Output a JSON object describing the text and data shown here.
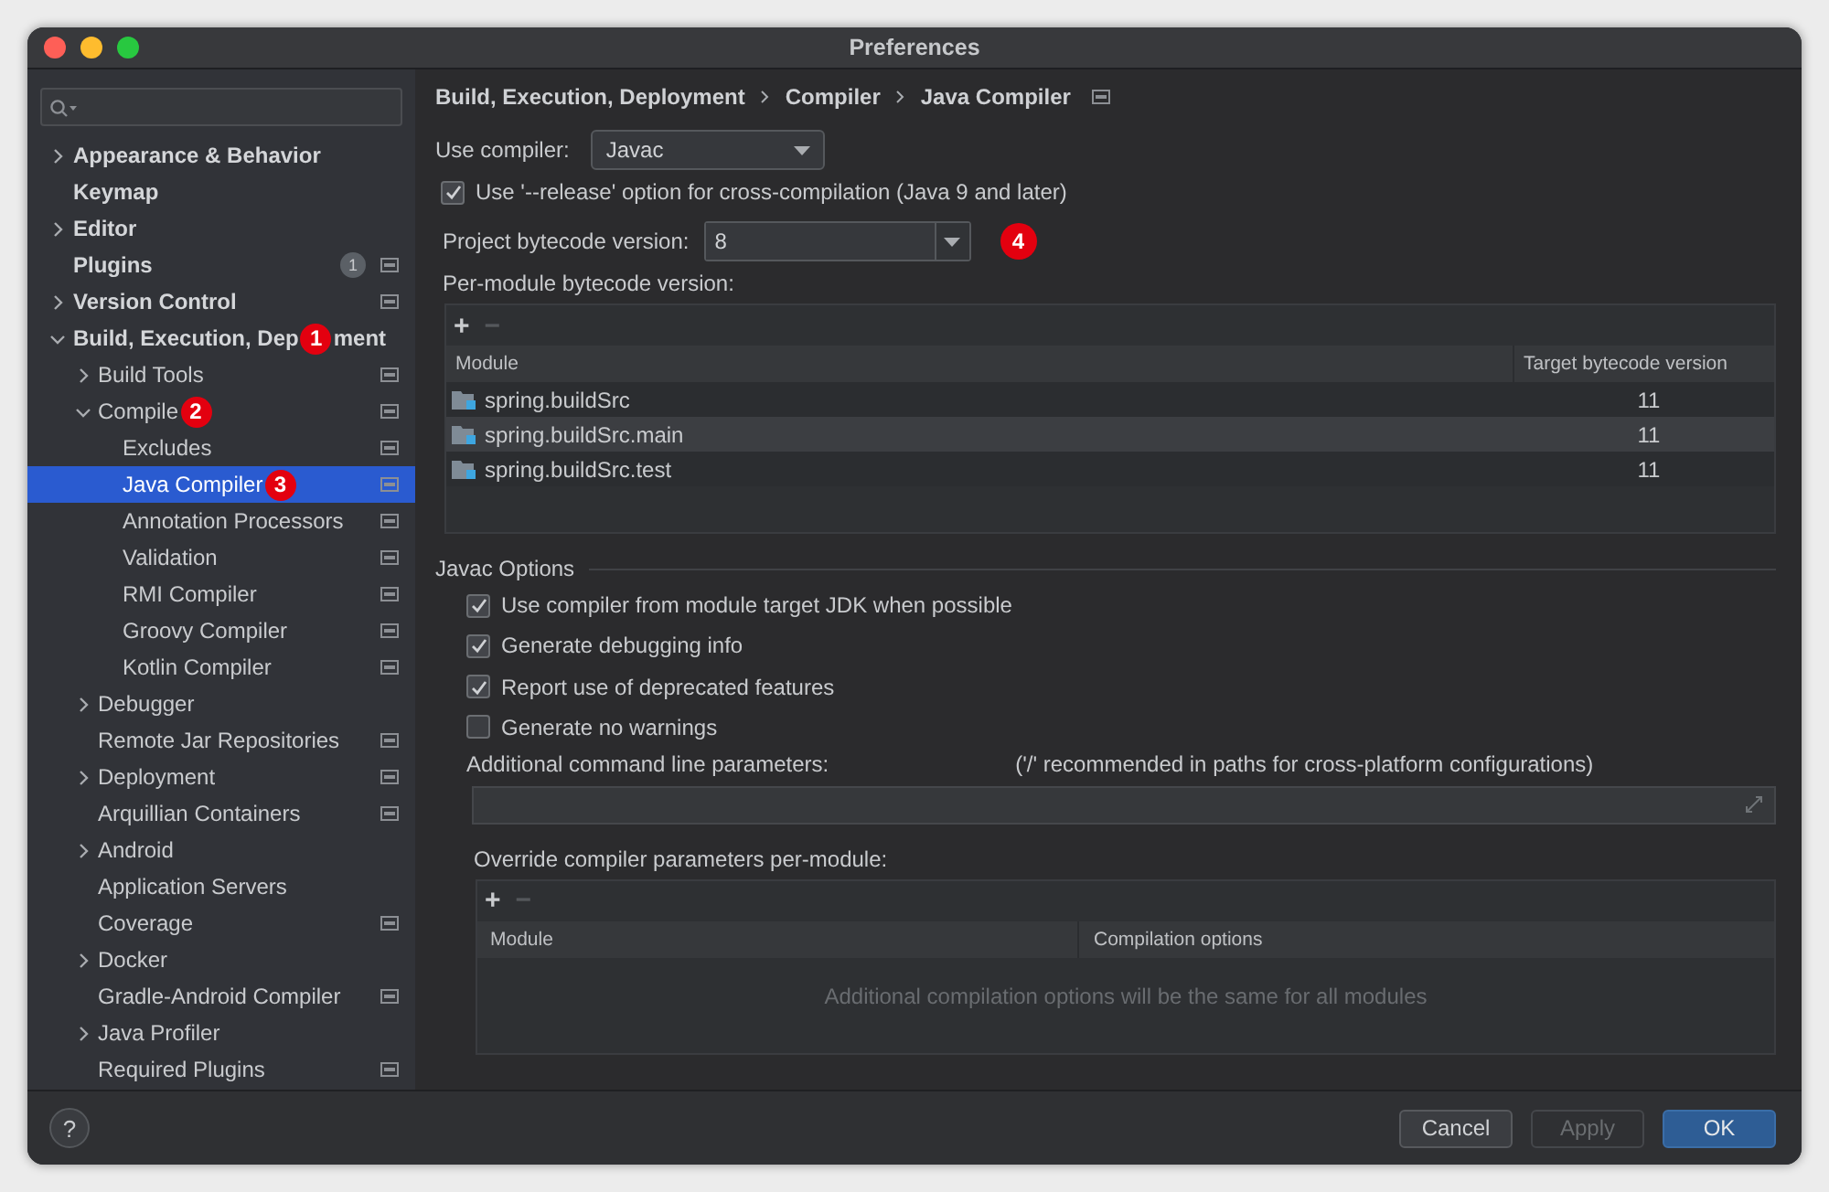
{
  "window": {
    "title": "Preferences"
  },
  "sidebar": {
    "items": [
      {
        "label": "Appearance & Behavior",
        "expanded": false,
        "selected": false,
        "project_icon": false
      },
      {
        "label": "Keymap",
        "selected": false,
        "project_icon": false
      },
      {
        "label": "Editor",
        "expanded": false,
        "selected": false,
        "project_icon": false
      },
      {
        "label": "Plugins",
        "selected": false,
        "project_icon": true,
        "count": "1"
      },
      {
        "label": "Version Control",
        "expanded": false,
        "selected": false,
        "project_icon": true
      },
      {
        "label": "Build, Execution, Dep",
        "label_tail": "ment",
        "annotation": "1",
        "expanded": true,
        "selected": false,
        "project_icon": false,
        "children": [
          {
            "label": "Build Tools",
            "expanded": false,
            "selected": false,
            "project_icon": true
          },
          {
            "label": "Compile",
            "annotation": "2",
            "expanded": true,
            "selected": false,
            "project_icon": true,
            "children": [
              {
                "label": "Excludes",
                "selected": false,
                "project_icon": true
              },
              {
                "label": "Java Compiler",
                "annotation": "3",
                "selected": true,
                "project_icon": true
              },
              {
                "label": "Annotation Processors",
                "selected": false,
                "project_icon": true
              },
              {
                "label": "Validation",
                "selected": false,
                "project_icon": true
              },
              {
                "label": "RMI Compiler",
                "selected": false,
                "project_icon": true
              },
              {
                "label": "Groovy Compiler",
                "selected": false,
                "project_icon": true
              },
              {
                "label": "Kotlin Compiler",
                "selected": false,
                "project_icon": true
              }
            ]
          },
          {
            "label": "Debugger",
            "expanded": false,
            "selected": false,
            "project_icon": false
          },
          {
            "label": "Remote Jar Repositories",
            "selected": false,
            "project_icon": true
          },
          {
            "label": "Deployment",
            "expanded": false,
            "selected": false,
            "project_icon": true
          },
          {
            "label": "Arquillian Containers",
            "selected": false,
            "project_icon": true
          },
          {
            "label": "Android",
            "expanded": false,
            "selected": false,
            "project_icon": false
          },
          {
            "label": "Application Servers",
            "selected": false,
            "project_icon": false
          },
          {
            "label": "Coverage",
            "selected": false,
            "project_icon": true
          },
          {
            "label": "Docker",
            "expanded": false,
            "selected": false,
            "project_icon": false
          },
          {
            "label": "Gradle-Android Compiler",
            "selected": false,
            "project_icon": true
          },
          {
            "label": "Java Profiler",
            "expanded": false,
            "selected": false,
            "project_icon": false
          },
          {
            "label": "Required Plugins",
            "selected": false,
            "project_icon": true
          }
        ]
      }
    ]
  },
  "breadcrumb": [
    "Build, Execution, Deployment",
    "Compiler",
    "Java Compiler"
  ],
  "use_compiler": {
    "label": "Use compiler:",
    "value": "Javac"
  },
  "release_option": {
    "label": "Use '--release' option for cross-compilation (Java 9 and later)",
    "checked": true
  },
  "project_bytecode": {
    "label": "Project bytecode version:",
    "value": "8",
    "annotation": "4"
  },
  "per_module": {
    "label": "Per-module bytecode version:",
    "add": "+",
    "remove": "−",
    "columns": [
      "Module",
      "Target bytecode version"
    ],
    "rows": [
      {
        "module": "spring.buildSrc",
        "target": "11",
        "selected": false
      },
      {
        "module": "spring.buildSrc.main",
        "target": "11",
        "selected": true
      },
      {
        "module": "spring.buildSrc.test",
        "target": "11",
        "selected": false
      }
    ]
  },
  "javac_options": {
    "title": "Javac Options",
    "checkboxes": [
      {
        "label": "Use compiler from module target JDK when possible",
        "checked": true
      },
      {
        "label": "Generate debugging info",
        "checked": true
      },
      {
        "label": "Report use of deprecated features",
        "checked": true
      },
      {
        "label": "Generate no warnings",
        "checked": false
      }
    ],
    "params_label": "Additional command line parameters:",
    "params_hint": "('/' recommended in paths for cross-platform configurations)",
    "override": {
      "label": "Override compiler parameters per-module:",
      "add": "+",
      "remove": "−",
      "columns": [
        "Module",
        "Compilation options"
      ],
      "empty_text": "Additional compilation options will be the same for all modules"
    }
  },
  "buttons": [
    {
      "label": "Cancel",
      "kind": "normal",
      "disabled": false
    },
    {
      "label": "Apply",
      "kind": "normal",
      "disabled": true
    },
    {
      "label": "OK",
      "kind": "default",
      "disabled": false
    }
  ],
  "help": "?"
}
